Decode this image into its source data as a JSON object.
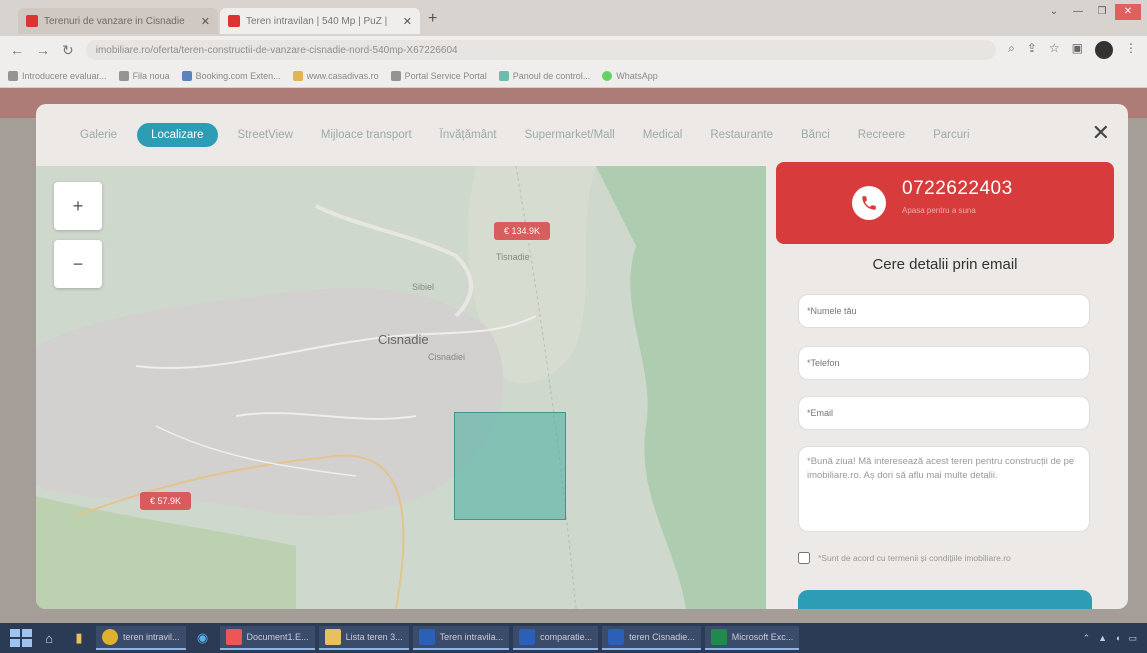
{
  "browser": {
    "tabs": [
      {
        "title": "Terenuri de vanzare in Cisnadie",
        "active": false
      },
      {
        "title": "Teren intravilan | 540 Mp | PuZ |",
        "active": true
      }
    ],
    "url": "imobiliare.ro/oferta/teren-constructii-de-vanzare-cisnadie-nord-540mp-X67226604",
    "bookmarks": [
      "Introducere evaluar...",
      "Fila noua",
      "Booking.com Exten...",
      "www.casadivas.ro",
      "Portal Service Portal",
      "Panoul de control...",
      "WhatsApp"
    ]
  },
  "modal": {
    "tabs": [
      "Galerie",
      "Localizare",
      "StreetView",
      "Mijloace transport",
      "Învățământ",
      "Supermarket/Mall",
      "Medical",
      "Restaurante",
      "Bănci",
      "Recreere",
      "Parcuri"
    ],
    "active_tab": "Localizare",
    "close_label": "✕"
  },
  "map": {
    "zoom_in": "+",
    "zoom_out": "−",
    "city": "Cisnadie",
    "labels": [
      "Sibiel",
      "Tisnadie",
      "Cisnadiei"
    ],
    "badges": [
      "€ 134.9K",
      "€ 57.9K"
    ]
  },
  "contact": {
    "phone": "0722622403",
    "phone_sub": "Apasa pentru a suna",
    "title": "Cere detalii prin email",
    "name_placeholder": "*Numele tău",
    "phone_placeholder": "*Telefon",
    "email_placeholder": "*Email",
    "message_value": "*Bună ziua! Mă interesează acest teren pentru construcții de pe imobiliare.ro. Aș dori să aflu mai multe detalii.",
    "consent_label": "*Sunt de acord cu termenii și condițiile imobiliare.ro"
  },
  "taskbar": {
    "apps": [
      "teren intravil...",
      "Document1.E...",
      "Lista teren 3...",
      "Teren intravila...",
      "comparatie...",
      "teren Cisnadie...",
      "Microsoft Exc..."
    ]
  }
}
